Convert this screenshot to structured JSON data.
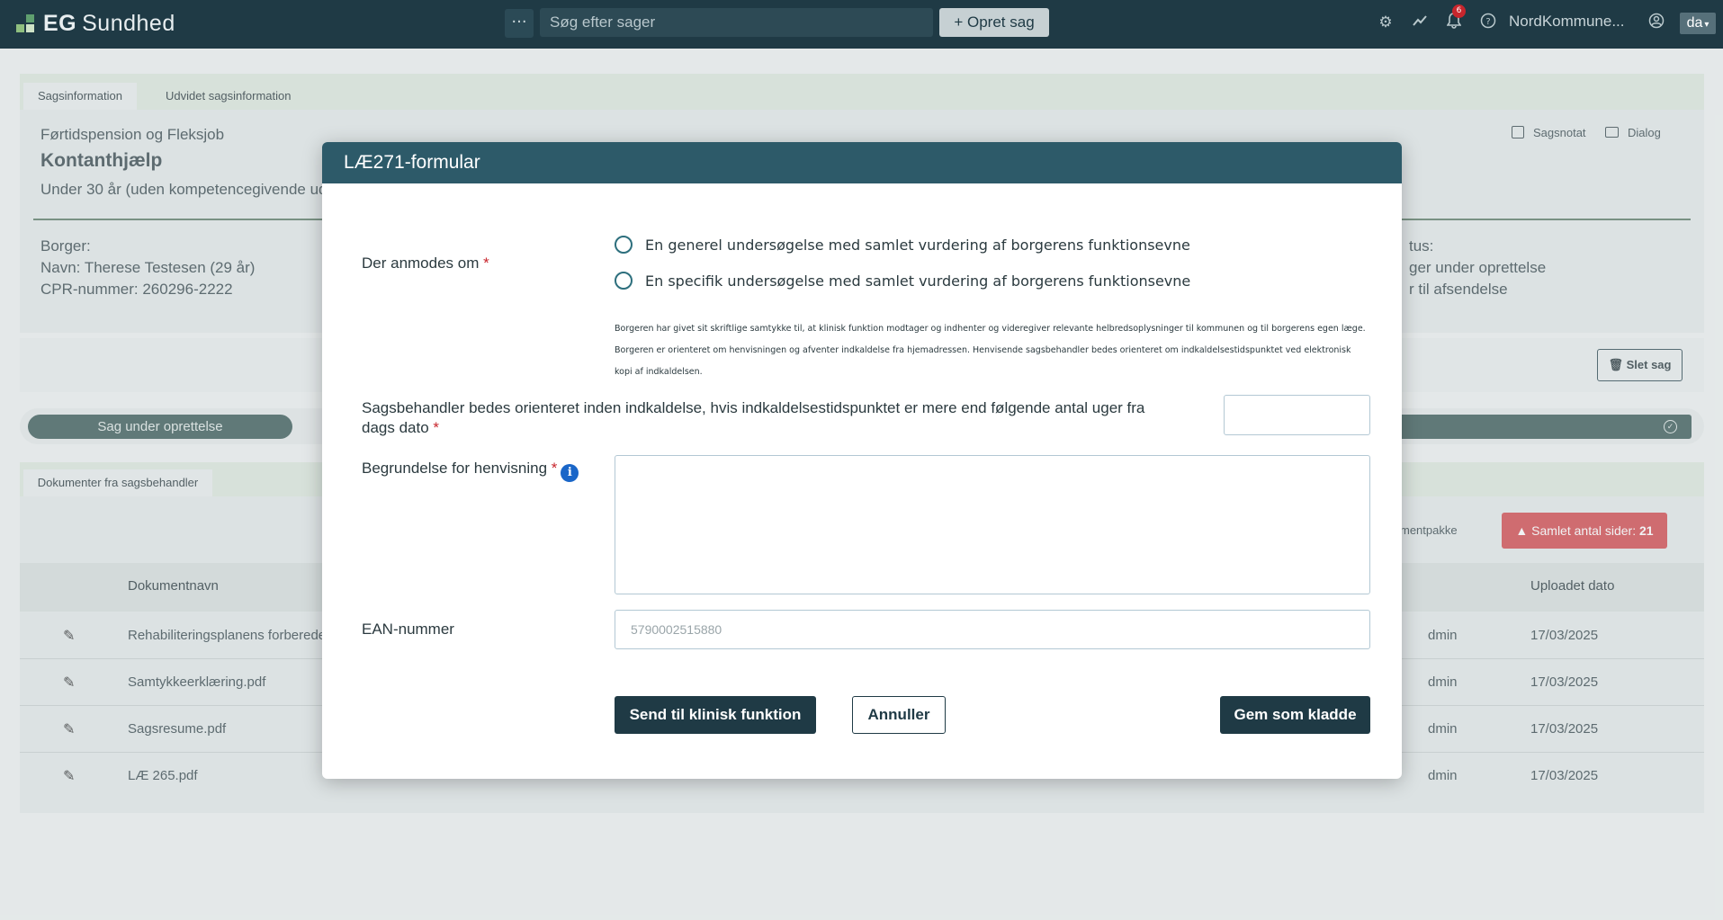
{
  "topbar": {
    "brand": "EG",
    "brand_name": "Sundhed",
    "menu_dots": "···",
    "search_placeholder": "Søg efter sager",
    "create_case": "+ Opret sag",
    "notification_count": "6",
    "org_name": "NordKommune...",
    "language": "da"
  },
  "case": {
    "tabs": [
      "Sagsinformation",
      "Udvidet sagsinformation"
    ],
    "category": "Førtidspension og Fleksjob",
    "title": "Kontanthjælp",
    "subtitle": "Under 30 år (uden kompetencegivende ud",
    "actions": [
      "Sagsnotat",
      "Dialog"
    ],
    "citizen_heading": "Borger:",
    "citizen_name": "Navn: Therese Testesen (29 år)",
    "citizen_cpr": "CPR-nummer: 260296-2222",
    "status_heading": "tus:",
    "status_line1": "ger under oprettelse",
    "status_line2": "r til afsendelse",
    "delete_case": "Slet sag",
    "status_pill": "Sag under oprettelse"
  },
  "documents": {
    "tab": "Dokumenter fra sagsbehandler",
    "package_label": "mentpakke",
    "pages_label": "Samlet antal sider:",
    "pages_count": "21",
    "col_name": "Dokumentnavn",
    "col_uploaded": "Uploadet dato",
    "rows": [
      {
        "name": "Rehabiliteringsplanens forberede",
        "user": "dmin",
        "date": "17/03/2025"
      },
      {
        "name": "Samtykkeerklæring.pdf",
        "user": "dmin",
        "date": "17/03/2025"
      },
      {
        "name": "Sagsresume.pdf",
        "user": "dmin",
        "date": "17/03/2025"
      },
      {
        "name": "LÆ 265.pdf",
        "user": "dmin",
        "date": "17/03/2025"
      }
    ]
  },
  "modal": {
    "title": "LÆ271-formular",
    "request_label": "Der anmodes om",
    "required_mark": "*",
    "options": [
      "En generel undersøgelse med samlet vurdering af borgerens funktionsevne",
      "En specifik undersøgelse med samlet vurdering af borgerens funktionsevne"
    ],
    "consent_text": "Borgeren har givet sit skriftlige samtykke til, at klinisk funktion modtager og indhenter og videregiver relevante helbredsoplysninger til kommunen og til borgerens egen læge. Borgeren er orienteret om henvisningen og afventer indkaldelse fra hjemadressen. Henvisende sagsbehandler bedes orienteret om indkaldelsestidspunktet ved elektronisk kopi af indkaldelsen.",
    "weeks_label": "Sagsbehandler bedes orienteret inden indkaldelse, hvis indkaldelsestidspunktet er mere end følgende antal uger fra dags dato",
    "weeks_value": "",
    "reason_label": "Begrundelse for henvisning",
    "reason_value": "",
    "ean_label": "EAN-nummer",
    "ean_placeholder": "5790002515880",
    "send_button": "Send til klinisk funktion",
    "cancel_button": "Annuller",
    "draft_button": "Gem som kladde"
  },
  "colors": {
    "topbar": "#1f3a45",
    "modal_header": "#2d5a69",
    "primary_button": "#1f3a45",
    "required": "#c8262d",
    "info": "#1a66c8",
    "alert": "#d24b4f"
  }
}
